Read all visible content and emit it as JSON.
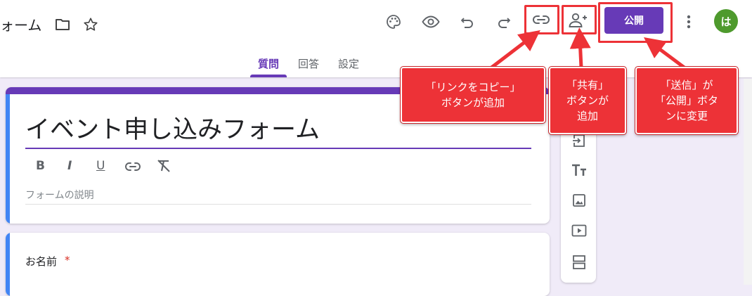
{
  "header": {
    "title_fragment": "ォーム",
    "publish_label": "公開",
    "avatar_initial": "は"
  },
  "tabs": [
    {
      "label": "質問",
      "active": true
    },
    {
      "label": "回答",
      "active": false
    },
    {
      "label": "設定",
      "active": false
    }
  ],
  "form": {
    "title": "イベント申し込みフォーム",
    "description_placeholder": "フォームの説明",
    "question_label": "お名前",
    "required_mark": "*"
  },
  "format_toolbar": [
    "B",
    "I",
    "U"
  ],
  "callouts": {
    "copy_link": [
      "「リンクをコピー」",
      "ボタンが追加"
    ],
    "share": [
      "「共有」",
      "ボタンが",
      "追加"
    ],
    "publish": [
      "「送信」が",
      "「公開」ボタ",
      "ンに変更"
    ]
  },
  "colors": {
    "accent": "#673ab7",
    "callout": "#ed3237",
    "avatar": "#4e9a2d",
    "stripe_blue": "#4285f4",
    "background": "#f0ebf8"
  },
  "icons": [
    "folder-icon",
    "star-icon",
    "palette-icon",
    "preview-eye-icon",
    "undo-icon",
    "redo-icon",
    "copy-link-icon",
    "add-person-icon",
    "more-vert-icon",
    "import-questions-icon",
    "title-text-icon",
    "image-icon",
    "video-icon",
    "section-icon",
    "link-icon",
    "clear-format-icon"
  ]
}
